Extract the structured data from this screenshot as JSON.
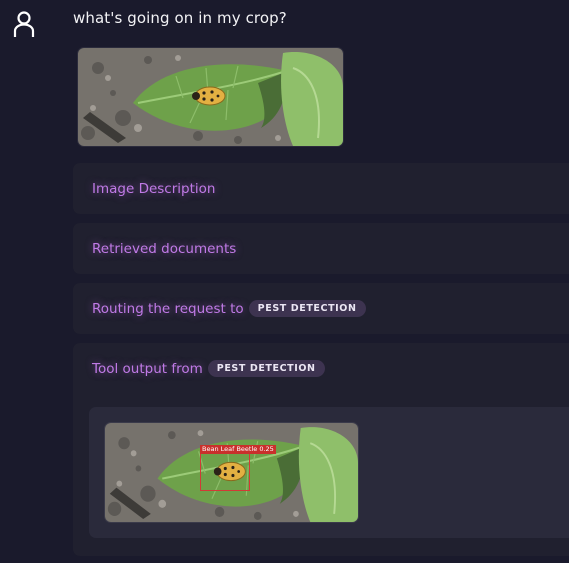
{
  "user": {
    "avatar_icon": "user-outline-icon",
    "message": "what's going on in my crop?"
  },
  "input_image": {
    "alt": "Beetle on bean leaf"
  },
  "steps": [
    {
      "label": "Image Description"
    },
    {
      "label": "Retrieved documents"
    },
    {
      "label": "Routing the request to",
      "tag": "PEST DETECTION"
    },
    {
      "label": "Tool output from",
      "tag": "PEST DETECTION"
    }
  ],
  "tool_output": {
    "detection_label": "Bean Leaf Beetle 0.25"
  },
  "colors": {
    "background": "#1a1a2c",
    "panel": "#20202f",
    "accent_text": "#c07ae6",
    "tag_bg": "#3d3350",
    "bbox": "#d23a36"
  }
}
